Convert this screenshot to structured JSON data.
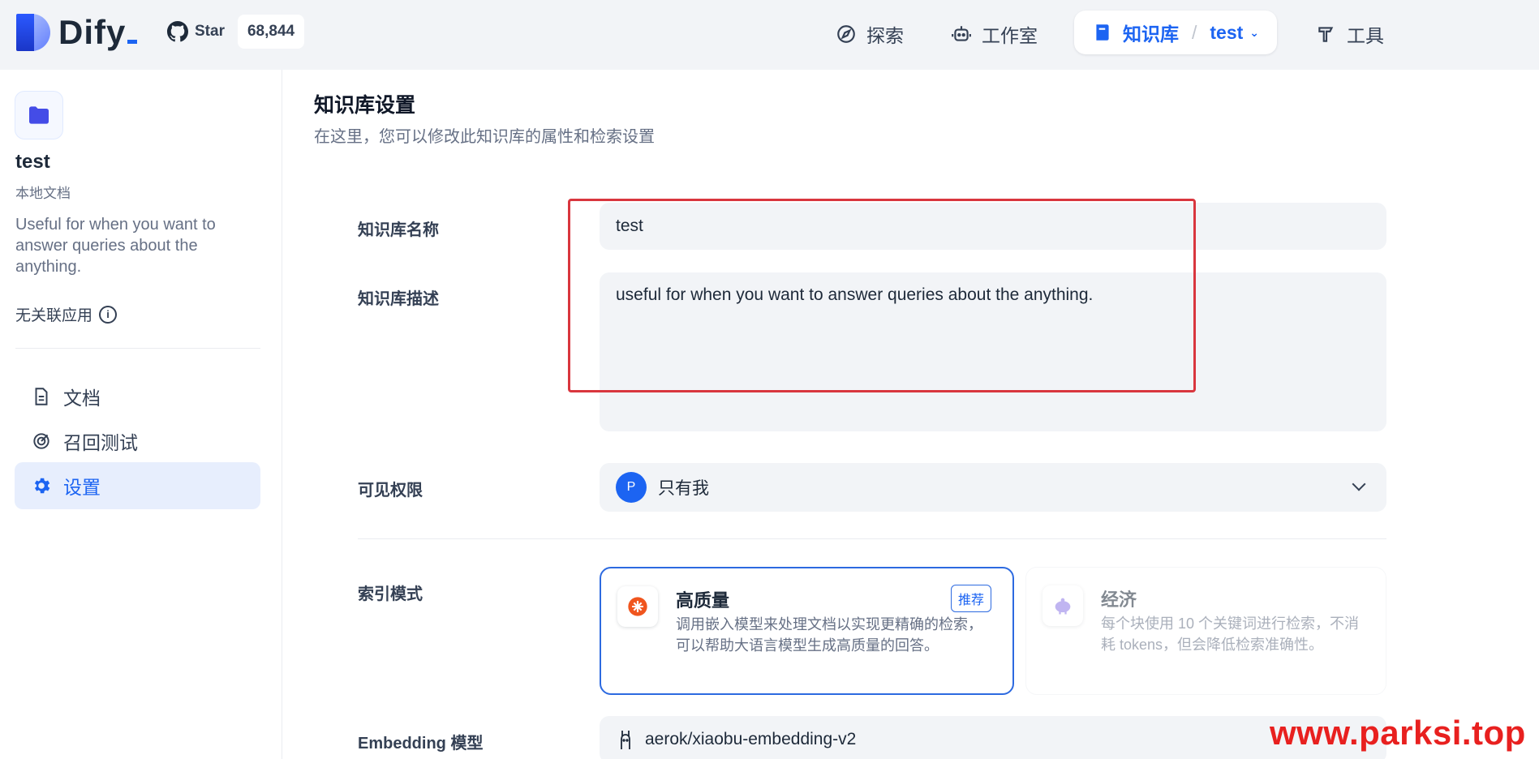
{
  "app": {
    "brand": "Dify",
    "brand_color": "#1c64f2"
  },
  "github": {
    "label": "Star",
    "count": "68,844"
  },
  "nav": {
    "explore": "探索",
    "studio": "工作室",
    "knowledge": "知识库",
    "dataset": "test",
    "tools": "工具"
  },
  "sidebar": {
    "dataset_name": "test",
    "dataset_type": "本地文档",
    "dataset_desc": "Useful for when you want to answer queries about the anything.",
    "related": "无关联应用",
    "menu": [
      {
        "label": "文档"
      },
      {
        "label": "召回测试"
      },
      {
        "label": "设置"
      }
    ]
  },
  "main": {
    "title": "知识库设置",
    "subtitle": "在这里，您可以修改此知识库的属性和检索设置",
    "name_label": "知识库名称",
    "name_value": "test",
    "desc_label": "知识库描述",
    "desc_value": "useful for when you want to answer queries about the anything.",
    "perm_label": "可见权限",
    "perm_avatar": "P",
    "perm_value": "只有我",
    "index_label": "索引模式",
    "index_hq": {
      "title": "高质量",
      "badge": "推荐",
      "desc": "调用嵌入模型来处理文档以实现更精确的检索，可以帮助大语言模型生成高质量的回答。"
    },
    "index_eco": {
      "title": "经济",
      "desc": "每个块使用 10 个关键词进行检索，不消耗 tokens，但会降低检索准确性。"
    },
    "embedding_label": "Embedding 模型",
    "embedding_value": "aerok/xiaobu-embedding-v2"
  },
  "watermark": "www.parksi.top"
}
